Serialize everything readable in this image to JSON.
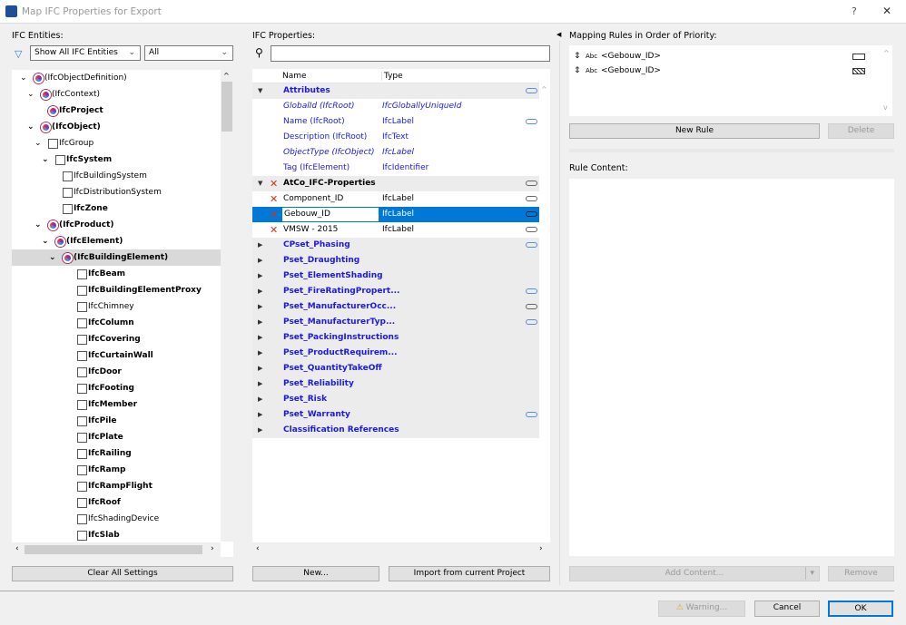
{
  "window": {
    "title": "Map IFC Properties for Export",
    "help": "?",
    "close": "✕"
  },
  "left": {
    "label": "IFC Entities:",
    "filter1": "Show All IFC Entities",
    "filter2": "All",
    "clear_button": "Clear All Settings",
    "tree": [
      {
        "text": "(IfcObjectDefinition)",
        "level": 0,
        "expanded": true,
        "bold": false,
        "icon": "ifc-entity-icon"
      },
      {
        "text": "(IfcContext)",
        "level": 1,
        "expanded": true,
        "bold": false,
        "icon": "ifc-entity-icon"
      },
      {
        "text": "IfcProject",
        "level": 2,
        "bold": true,
        "icon": "ifc-entity-icon"
      },
      {
        "text": "(IfcObject)",
        "level": 1,
        "expanded": true,
        "bold": true,
        "icon": "ifc-entity-icon"
      },
      {
        "text": "IfcGroup",
        "level": 2,
        "expanded": true,
        "bold": false,
        "icon": "group-icon"
      },
      {
        "text": "IfcSystem",
        "level": 3,
        "expanded": true,
        "bold": true,
        "icon": "system-icon"
      },
      {
        "text": "IfcBuildingSystem",
        "level": 4,
        "bold": false,
        "icon": "system-icon"
      },
      {
        "text": "IfcDistributionSystem",
        "level": 4,
        "bold": false,
        "icon": "system-icon"
      },
      {
        "text": "IfcZone",
        "level": 4,
        "bold": true,
        "icon": "zone-icon"
      },
      {
        "text": "(IfcProduct)",
        "level": 2,
        "expanded": true,
        "bold": true,
        "icon": "ifc-entity-icon"
      },
      {
        "text": "(IfcElement)",
        "level": 3,
        "expanded": true,
        "bold": true,
        "icon": "ifc-entity-icon"
      },
      {
        "text": "(IfcBuildingElement)",
        "level": 4,
        "expanded": true,
        "bold": true,
        "icon": "ifc-entity-icon",
        "selected": true
      },
      {
        "text": "IfcBeam",
        "level": 6,
        "bold": true,
        "icon": "beam-icon"
      },
      {
        "text": "IfcBuildingElementProxy",
        "level": 6,
        "bold": true,
        "icon": "proxy-icon"
      },
      {
        "text": "IfcChimney",
        "level": 6,
        "bold": false,
        "icon": "chimney-icon"
      },
      {
        "text": "IfcColumn",
        "level": 6,
        "bold": true,
        "icon": "column-icon"
      },
      {
        "text": "IfcCovering",
        "level": 6,
        "bold": true,
        "icon": "covering-icon"
      },
      {
        "text": "IfcCurtainWall",
        "level": 6,
        "bold": true,
        "icon": "curtain-wall-icon"
      },
      {
        "text": "IfcDoor",
        "level": 6,
        "bold": true,
        "icon": "door-icon"
      },
      {
        "text": "IfcFooting",
        "level": 6,
        "bold": true,
        "icon": "footing-icon"
      },
      {
        "text": "IfcMember",
        "level": 6,
        "bold": true,
        "icon": "member-icon"
      },
      {
        "text": "IfcPile",
        "level": 6,
        "bold": true,
        "icon": "pile-icon"
      },
      {
        "text": "IfcPlate",
        "level": 6,
        "bold": true,
        "icon": "plate-icon"
      },
      {
        "text": "IfcRailing",
        "level": 6,
        "bold": true,
        "icon": "railing-icon"
      },
      {
        "text": "IfcRamp",
        "level": 6,
        "bold": true,
        "icon": "ramp-icon"
      },
      {
        "text": "IfcRampFlight",
        "level": 6,
        "bold": true,
        "icon": "ramp-flight-icon"
      },
      {
        "text": "IfcRoof",
        "level": 6,
        "bold": true,
        "icon": "roof-icon"
      },
      {
        "text": "IfcShadingDevice",
        "level": 6,
        "bold": false,
        "icon": "shading-device-icon"
      },
      {
        "text": "IfcSlab",
        "level": 6,
        "bold": true,
        "icon": "slab-icon"
      }
    ]
  },
  "middle": {
    "label": "IFC Properties:",
    "search_placeholder": "",
    "col_name": "Name",
    "col_type": "Type",
    "new_button": "New...",
    "import_button": "Import from current Project",
    "rows": [
      {
        "kind": "group",
        "name": "Attributes",
        "expanded": true,
        "blue": true,
        "link": "blue"
      },
      {
        "name": "GlobalId (IfcRoot)",
        "type": "IfcGloballyUniqueId",
        "blue": true,
        "italic": true
      },
      {
        "name": "Name (IfcRoot)",
        "type": "IfcLabel",
        "blue": true,
        "link": "blue"
      },
      {
        "name": "Description (IfcRoot)",
        "type": "IfcText",
        "blue": true
      },
      {
        "name": "ObjectType (IfcObject)",
        "type": "IfcLabel",
        "blue": true,
        "italic": true
      },
      {
        "name": "Tag (IfcElement)",
        "type": "IfcIdentifier",
        "blue": true
      },
      {
        "kind": "group",
        "name": "AtCo_IFC-Properties",
        "expanded": true,
        "delete": true,
        "link": "gray"
      },
      {
        "name": "Component_ID",
        "type": "IfcLabel",
        "delete": true,
        "link": "gray"
      },
      {
        "name": "Gebouw_ID",
        "type": "IfcLabel",
        "delete": true,
        "link": "gray",
        "selected": true
      },
      {
        "name": "VMSW - 2015",
        "type": "IfcLabel",
        "delete": true,
        "link": "gray"
      },
      {
        "kind": "group",
        "name": "CPset_Phasing",
        "blue": true,
        "link": "blue"
      },
      {
        "kind": "group",
        "name": "Pset_Draughting",
        "blue": true
      },
      {
        "kind": "group",
        "name": "Pset_ElementShading",
        "blue": true
      },
      {
        "kind": "group",
        "name": "Pset_FireRatingPropert...",
        "blue": true,
        "link": "blue"
      },
      {
        "kind": "group",
        "name": "Pset_ManufacturerOcc...",
        "blue": true,
        "link": "gray"
      },
      {
        "kind": "group",
        "name": "Pset_ManufacturerTyp...",
        "blue": true,
        "link": "blue"
      },
      {
        "kind": "group",
        "name": "Pset_PackingInstructions",
        "blue": true
      },
      {
        "kind": "group",
        "name": "Pset_ProductRequirem...",
        "blue": true
      },
      {
        "kind": "group",
        "name": "Pset_QuantityTakeOff",
        "blue": true
      },
      {
        "kind": "group",
        "name": "Pset_Reliability",
        "blue": true
      },
      {
        "kind": "group",
        "name": "Pset_Risk",
        "blue": true
      },
      {
        "kind": "group",
        "name": "Pset_Warranty",
        "blue": true,
        "link": "blue"
      },
      {
        "kind": "group",
        "name": "Classification References",
        "blue": true
      }
    ]
  },
  "right": {
    "label": "Mapping Rules in Order of Priority:",
    "rules": [
      {
        "type": "Abc",
        "text": "<Gebouw_ID>",
        "icon": "building-element-icon"
      },
      {
        "type": "Abc",
        "text": "<Gebouw_ID>",
        "icon": "hatch-icon"
      }
    ],
    "new_rule": "New Rule",
    "delete": "Delete",
    "content_label": "Rule Content:",
    "add_content": "Add Content...",
    "remove": "Remove"
  },
  "footer": {
    "warning": "Warning...",
    "cancel": "Cancel",
    "ok": "OK"
  },
  "colors": {
    "selection": "#0078d7",
    "blue_text": "#1a1ae6",
    "delete_x": "#e03010"
  }
}
